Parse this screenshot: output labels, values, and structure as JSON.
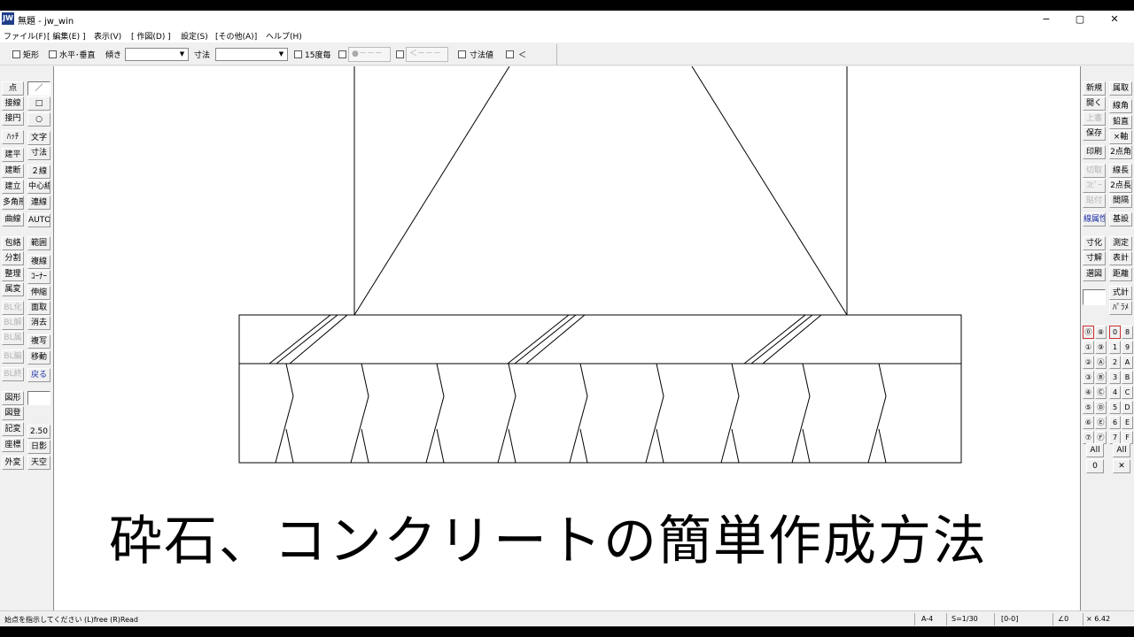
{
  "window": {
    "app_icon": "JW",
    "title": "無題 - jw_win",
    "minimize": "−",
    "maximize": "▢",
    "close": "✕"
  },
  "menu": [
    "ファイル(F)",
    "[ 編集(E) ]",
    "表示(V)",
    "[ 作図(D) ]",
    "設定(S)",
    "[その他(A)]",
    "ヘルプ(H)"
  ],
  "toolbar": {
    "rect_label": "矩形",
    "horiz_vert_label": "水平･垂直",
    "slope_label": "傾き",
    "slope_value": "",
    "dim_label": "寸法",
    "dim_value": "",
    "angle15_label": "15度毎",
    "line_style_box": "●－－－",
    "arrow_box": "＜－－－",
    "dim_value_label": "寸法値",
    "last_label": "＜"
  },
  "left_panel": {
    "col1": [
      "点",
      "接線",
      "接円",
      "ﾊｯﾁ",
      "建平",
      "建断",
      "建立",
      "多角形",
      "曲線",
      "包絡",
      "分割",
      "整理",
      "属変",
      "BL化",
      "BL解",
      "BL属",
      "BL編",
      "BL終",
      "図形",
      "図登",
      "記変",
      "座標",
      "外変"
    ],
    "col2": [
      "／",
      "□",
      "○",
      "文字",
      "寸法",
      "２線",
      "中心線",
      "連線",
      "AUTO",
      "範囲",
      "複線",
      "ｺｰﾅｰ",
      "伸縮",
      "面取",
      "消去",
      "複写",
      "移動",
      "戻る",
      "",
      "2.50",
      "日影",
      "天空"
    ]
  },
  "right_panel": {
    "col1": [
      "新規",
      "開く",
      "上書",
      "保存",
      "印刷",
      "切取",
      "ｺﾋﾟｰ",
      "貼付",
      "線属性",
      "寸化",
      "寸解",
      "選図"
    ],
    "col2": [
      "属取",
      "線角",
      "鉛直",
      "×軸",
      "2点角",
      "線長",
      "2点長",
      "間隔",
      "基設",
      "測定",
      "表計",
      "距離",
      "式計",
      "ﾊﾟﾗﾒ"
    ],
    "layers_circled": [
      "⓪",
      "①",
      "②",
      "③",
      "④",
      "⑤",
      "⑥",
      "⑦"
    ],
    "layers_circled_hex": [
      "⑧",
      "⑨",
      "Ⓐ",
      "Ⓑ",
      "Ⓒ",
      "Ⓓ",
      "Ⓔ",
      "Ⓕ"
    ],
    "groups_a": [
      "0",
      "1",
      "2",
      "3",
      "4",
      "5",
      "6",
      "7"
    ],
    "groups_b": [
      "8",
      "9",
      "A",
      "B",
      "C",
      "D",
      "E",
      "F"
    ],
    "all_left": "All",
    "all_right": "All",
    "zero_btn": "0",
    "x_btn": "✕"
  },
  "caption": "砕石、コンクリートの簡単作成方法",
  "status": {
    "message": "始点を指示してください (L)free (R)Read",
    "paper": "A-4",
    "scale": "S=1/30",
    "layer": "[0-0]",
    "angle": "∠0",
    "zoom": "× 6.42"
  }
}
